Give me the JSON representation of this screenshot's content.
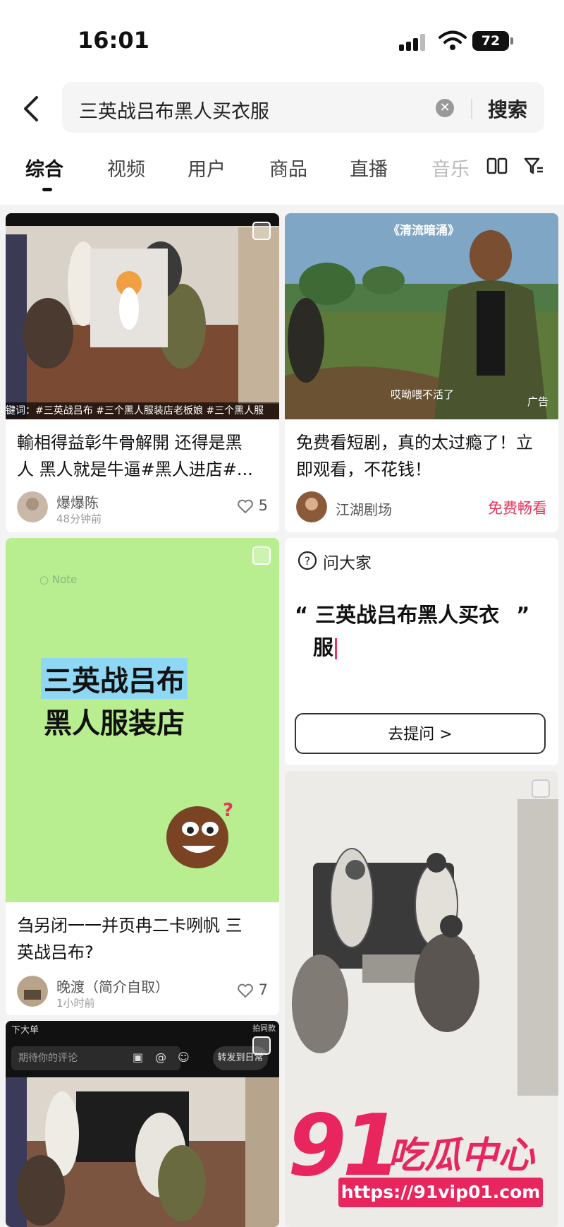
{
  "status_bar": {
    "time": "16:01",
    "battery": "72"
  },
  "search": {
    "query": "三英战吕布黑人买衣服",
    "button": "搜索"
  },
  "tabs": [
    {
      "label": "综合"
    },
    {
      "label": "视频"
    },
    {
      "label": "用户"
    },
    {
      "label": "商品"
    },
    {
      "label": "直播"
    },
    {
      "label": "音乐"
    }
  ],
  "cards": {
    "video1": {
      "tagline": "键词：#三英战吕布 #三个黑人服装店老板娘 #三个黑人服",
      "title_line1": "輸相得益彰牛骨解開 还得是黑",
      "title_line2": "人 黑人就是牛逼#黑人进店#...",
      "author": "爆爆陈",
      "time_ago": "48分钟前",
      "likes": "5"
    },
    "ad": {
      "overlay_title": "《清流暗涌》",
      "subtitle": "哎呦喂不活了",
      "ad_tag": "广告",
      "title_line1": "免费看短剧，真的太过瘾了！立",
      "title_line2": "即观看，不花钱！",
      "author": "江湖剧场",
      "cta": "免费畅看"
    },
    "note": {
      "logo": "Note",
      "line1": "三英战吕布",
      "line2": "黑人服装店",
      "title_line1": "刍另闭一一并页冉二卡咧帆 三",
      "title_line2": "英战吕布?",
      "author": "晚渡（简介自取）",
      "time_ago": "1小时前",
      "likes": "7"
    },
    "ask": {
      "label": "问大家",
      "quote_open": "“",
      "question_line1": "三英战吕布黑人买衣",
      "quote_close": "”",
      "question_line2": "服",
      "button": "去提问 >"
    },
    "video2": {
      "header": "下大单",
      "top_right": "拍同款",
      "comment_placeholder": "期待你的评论",
      "share_button": "转发到日常"
    }
  },
  "watermark": {
    "number": "91",
    "text": "吃瓜中心",
    "url": "https://91vip01.com"
  },
  "colors": {
    "accent": "#e8355d",
    "note_bg": "#b8ee8f",
    "highlight": "#8fd8f5"
  }
}
